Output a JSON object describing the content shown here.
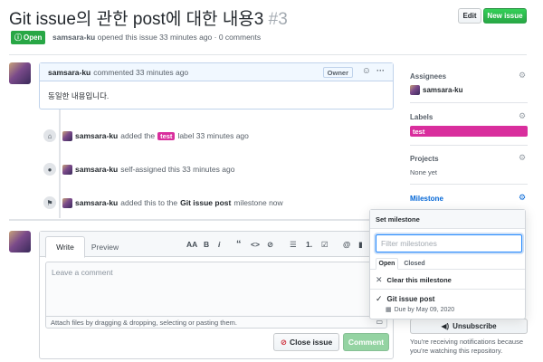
{
  "header": {
    "title": "Git issue의 관한 post에 대한 내용3",
    "number": "#3",
    "edit_label": "Edit",
    "new_issue_label": "New issue",
    "state_label": "Open",
    "author": "samsara-ku",
    "meta_text": "opened this issue 33 minutes ago · 0 comments"
  },
  "comment": {
    "author": "samsara-ku",
    "time": "commented 33 minutes ago",
    "owner_badge": "Owner",
    "body": "동일한 내용입니다.",
    "more": "···"
  },
  "timeline": [
    {
      "icon": "tag-icon",
      "user": "samsara-ku",
      "pre": "added the",
      "label": "test",
      "post": "label 33 minutes ago"
    },
    {
      "icon": "person-icon",
      "user": "samsara-ku",
      "pre": "self-assigned this 33 minutes ago"
    },
    {
      "icon": "milestone-icon",
      "user": "samsara-ku",
      "pre": "added this to the",
      "bold": "Git issue post",
      "post": "milestone now"
    }
  ],
  "editor": {
    "tab_write": "Write",
    "tab_preview": "Preview",
    "placeholder": "Leave a comment",
    "attach_text": "Attach files by dragging & dropping, selecting or pasting them.",
    "close_label": "Close issue",
    "comment_label": "Comment",
    "toolbar": [
      "AA",
      "B",
      "i",
      "“",
      "<>",
      "⊘",
      "☰",
      "1.",
      "☑",
      "@",
      "▮"
    ]
  },
  "sidebar": {
    "assignees_heading": "Assignees",
    "assignee_name": "samsara-ku",
    "labels_heading": "Labels",
    "label_name": "test",
    "label_color": "#d92e9d",
    "projects_heading": "Projects",
    "projects_value": "None yet",
    "milestone_heading": "Milestone",
    "unsubscribe_label": "Unsubscribe",
    "notify_text": "You're receiving notifications because you're watching this repository."
  },
  "milestone_popover": {
    "title": "Set milestone",
    "filter_placeholder": "Filter milestones",
    "tab_open": "Open",
    "tab_closed": "Closed",
    "clear_label": "Clear this milestone",
    "item_title": "Git issue post",
    "item_due": "Due by May 09, 2020"
  },
  "colors": {
    "accent_green": "#28a745",
    "link_blue": "#0366d6",
    "label_pink": "#d92e9d"
  }
}
